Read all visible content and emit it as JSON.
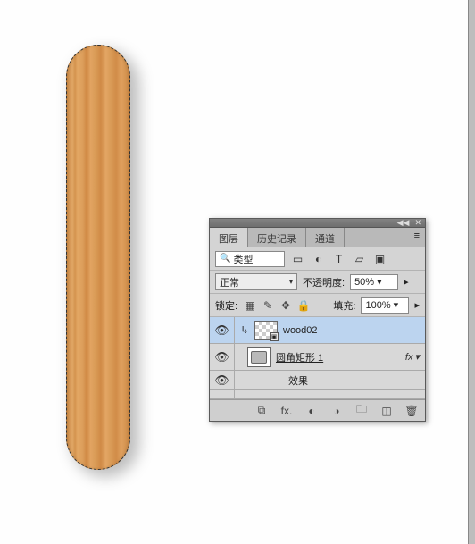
{
  "tabs": {
    "layers": "图层",
    "history": "历史记录",
    "channels": "通道"
  },
  "filter": {
    "label": "类型"
  },
  "blend": {
    "mode": "正常",
    "opacity_label": "不透明度:",
    "opacity_value": "50%"
  },
  "lock": {
    "label": "锁定:",
    "fill_label": "填充:",
    "fill_value": "100%"
  },
  "layers_list": [
    {
      "name": "wood02"
    },
    {
      "name": "圆角矩形 1",
      "fx": "fx"
    }
  ],
  "effects": {
    "label": "效果"
  },
  "icons": {
    "collapse": "◀◀",
    "close": "✕",
    "menu": "≡",
    "search": "🔍",
    "image_filter": "▭",
    "adjust_filter": "◐",
    "text_filter": "T",
    "shape_filter": "▱",
    "smart_filter": "▣",
    "chev_down": "▾",
    "side_caret": "▸",
    "lock_trans": "▦",
    "lock_brush": "✎",
    "lock_move": "✥",
    "lock_all": "🔒",
    "eye": "👁",
    "link_small": "↳",
    "smart_badge": "▣",
    "twirl": "▾",
    "link": "⧉",
    "fx": "fx.",
    "mask": "◐",
    "adjust": "◑",
    "folder": "🗀",
    "new": "◫",
    "trash": "🗑"
  }
}
